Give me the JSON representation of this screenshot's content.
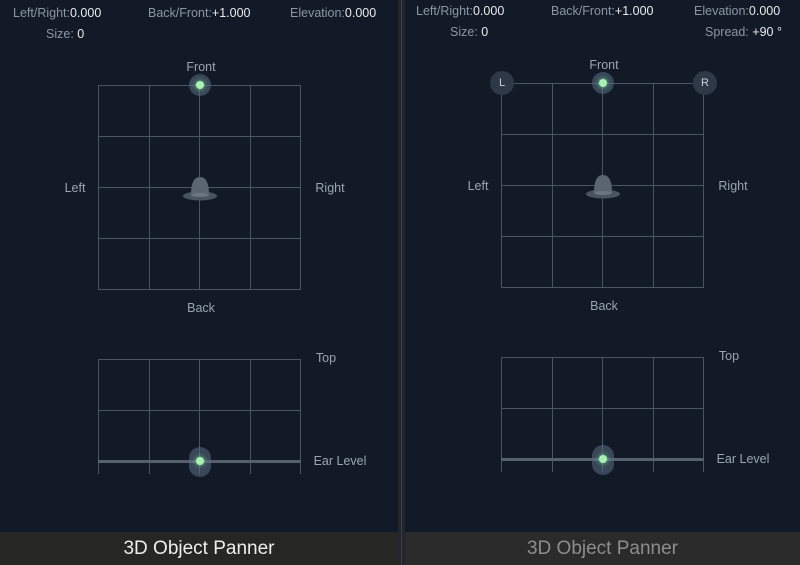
{
  "panels": [
    {
      "params": {
        "left_right": {
          "label": "Left/Right:",
          "value": "0.000"
        },
        "back_front": {
          "label": "Back/Front:",
          "value": "+1.000"
        },
        "elevation": {
          "label": "Elevation:",
          "value": "0.000"
        },
        "size": {
          "label": "Size:",
          "value": "0"
        }
      },
      "labels": {
        "front": "Front",
        "back": "Back",
        "left": "Left",
        "right": "Right",
        "top": "Top",
        "ear_level": "Ear Level"
      },
      "title": "3D Object Panner"
    },
    {
      "params": {
        "left_right": {
          "label": "Left/Right:",
          "value": "0.000"
        },
        "back_front": {
          "label": "Back/Front:",
          "value": "+1.000"
        },
        "elevation": {
          "label": "Elevation:",
          "value": "0.000"
        },
        "size": {
          "label": "Size:",
          "value": "0"
        },
        "spread": {
          "label": "Spread:",
          "value": "+90 °"
        }
      },
      "labels": {
        "front": "Front",
        "back": "Back",
        "left": "Left",
        "right": "Right",
        "top": "Top",
        "ear_level": "Ear Level"
      },
      "channels": {
        "left": "L",
        "right": "R"
      },
      "title": "3D Object Panner"
    }
  ],
  "colors": {
    "background": "#121a27",
    "grid": "#4a5563",
    "puck": "#a8f0b4"
  }
}
